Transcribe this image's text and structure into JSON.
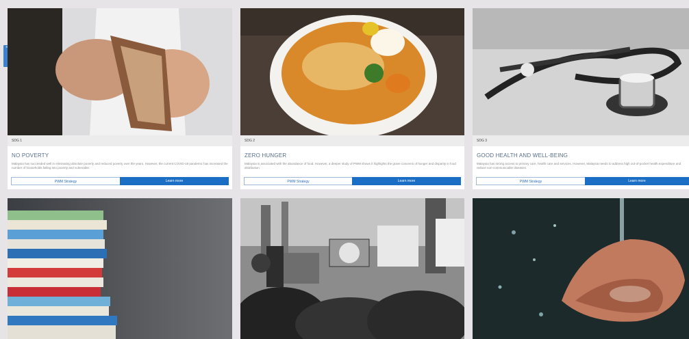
{
  "cards": [
    {
      "tag": "SDG 1",
      "title": "NO POVERTY",
      "desc": "Malaysia has succeeded well in eliminating absolute poverty and reduced poverty over the years. However, the current COVID-19 pandemic has increased the number of households falling into poverty and vulnerable.",
      "btn_secondary": "PWM Strategy",
      "btn_primary": "Learn more",
      "image_subject": "hands-holding-wallet"
    },
    {
      "tag": "SDG 2",
      "title": "ZERO HUNGER",
      "desc": "Malaysia is associated with the abundance of food. However, a deeper study of PWM shows it highlights the grave concerns of hunger and disparity in food distribution.",
      "btn_secondary": "PWM Strategy",
      "btn_primary": "Learn more",
      "image_subject": "bowl-of-noodles"
    },
    {
      "tag": "SDG 3",
      "title": "GOOD HEALTH AND WELL-BEING",
      "desc": "Malaysia has strong access to primary care, health care and services. However, Malaysia needs to address high out-of-pocket health expenditure and reduce non-communicable diseases.",
      "btn_secondary": "PWM Strategy",
      "btn_primary": "Learn more",
      "image_subject": "stethoscope"
    },
    {
      "image_subject": "stack-of-books"
    },
    {
      "image_subject": "protest-crowd"
    },
    {
      "image_subject": "water-in-hands"
    }
  ],
  "side_tab": "≡",
  "colors": {
    "accent": "#1a6fc4",
    "background": "#e6e4e6"
  }
}
